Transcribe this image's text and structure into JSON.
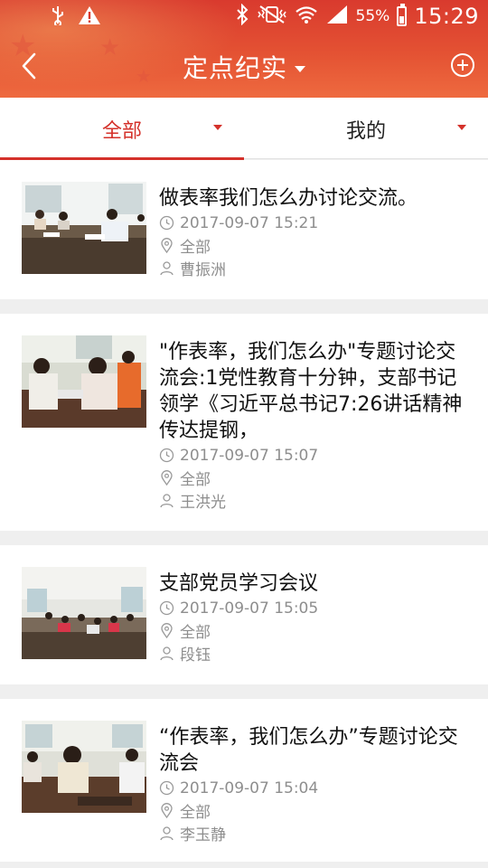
{
  "status_bar": {
    "battery": "55%",
    "time": "15:29",
    "icons": [
      "usb-icon",
      "warning-icon",
      "bluetooth-icon",
      "vibrate-icon",
      "wifi-icon",
      "signal-icon",
      "battery-charging-icon"
    ]
  },
  "app_bar": {
    "title": "定点纪实"
  },
  "tabs": [
    {
      "label": "全部"
    },
    {
      "label": "我的"
    }
  ],
  "colors": {
    "accent": "#d4312a",
    "header_gradient": [
      "#d93a2e",
      "#ee6a3f"
    ],
    "meta_text": "#8e8e8e"
  },
  "items": [
    {
      "title": "做表率我们怎么办讨论交流。",
      "datetime": "2017-09-07 15:21",
      "location": "全部",
      "author": "曹振洲"
    },
    {
      "title": "\"作表率，我们怎么办\"专题讨论交流会:1党性教育十分钟，支部书记领学《习近平总书记7:26讲话精神传达提钢，",
      "datetime": "2017-09-07 15:07",
      "location": "全部",
      "author": "王洪光"
    },
    {
      "title": "支部党员学习会议",
      "datetime": "2017-09-07 15:05",
      "location": "全部",
      "author": "段钰"
    },
    {
      "title": "“作表率，我们怎么办”专题讨论交流会",
      "datetime": "2017-09-07 15:04",
      "location": "全部",
      "author": "李玉静"
    }
  ]
}
